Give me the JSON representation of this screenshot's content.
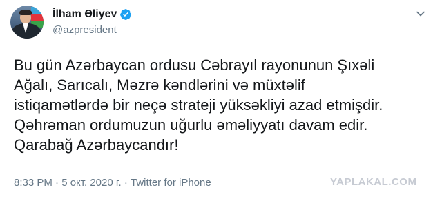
{
  "author": {
    "name": "İlham Əliyev",
    "handle": "@azpresident",
    "verified": true,
    "avatar_icon": "user-avatar"
  },
  "tweet": {
    "text": "Bu gün Azərbaycan ordusu Cəbrayıl rayonunun Şıxəli\nAğalı, Sarıcalı, Məzrə kəndlərini və müxtəlif\nistiqamətlərdə bir neçə strateji yüksəkliyi azad etmişdir.\nQəhrəman ordumuzun uğurlu əməliyyatı davam edir.\nQarabağ Azərbaycandır!",
    "time": "8:33 PM",
    "date": "5 окт. 2020 г.",
    "separator": "·",
    "source": "Twitter for iPhone",
    "meta_line": "8:33 PM · 5 окт. 2020 г. · Twitter for iPhone"
  },
  "watermark": "YAPLAKAL.COM",
  "icons": {
    "verified": "verified-badge-icon",
    "menu": "chevron-down-icon"
  },
  "colors": {
    "text": "#14171a",
    "secondary": "#657786",
    "verified_blue": "#1da1f2",
    "watermark": "#c7cbd3"
  }
}
